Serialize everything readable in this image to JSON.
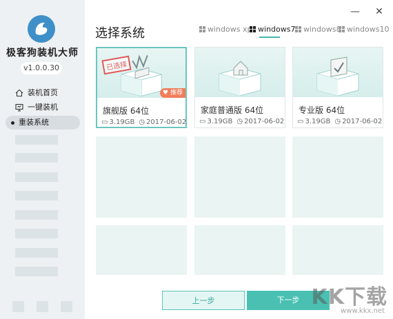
{
  "sidebar": {
    "app_name": "极客狗装机大师",
    "version": "v1.0.0.30",
    "nav": [
      {
        "label": "装机首页",
        "icon": "home-icon"
      },
      {
        "label": "一键装机",
        "icon": "monitor-icon"
      },
      {
        "label": "重装系统",
        "icon": "bullet-icon"
      }
    ]
  },
  "window": {
    "minimize": "—",
    "close": "✕"
  },
  "header": {
    "title": "选择系统",
    "tabs": [
      "windows xp",
      "windows7",
      "windows8",
      "windows10"
    ],
    "active_tab": "windows7"
  },
  "cards": [
    {
      "name": "旗舰版 64位",
      "size": "3.19GB",
      "date": "2017-06-02",
      "stamp": "已选择",
      "tag": "推荐"
    },
    {
      "name": "家庭普通版 64位",
      "size": "3.19GB",
      "date": "2017-06-02"
    },
    {
      "name": "专业版 64位",
      "size": "3.19GB",
      "date": "2017-06-02"
    }
  ],
  "buttons": {
    "prev": "上一步",
    "next": "下一步"
  },
  "watermark": {
    "text": "KK下载",
    "sub": "www.kkx.net"
  },
  "colors": {
    "accent": "#49c0b2",
    "sidebar_bg": "#eef1f3",
    "tag": "#f27d5a",
    "stamp": "#e05a5a"
  }
}
